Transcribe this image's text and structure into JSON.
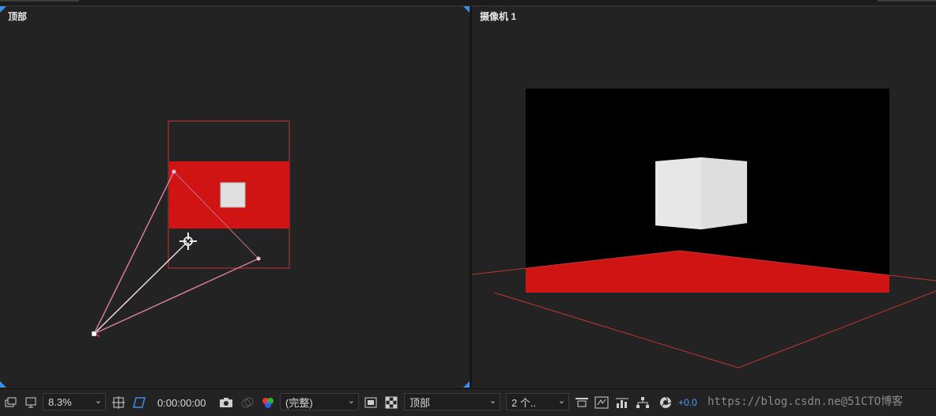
{
  "left_viewer": {
    "label": "顶部"
  },
  "right_viewer": {
    "label": "摄像机 1"
  },
  "toolbar": {
    "zoom": "8.3%",
    "timecode": "0:00:00:00",
    "resolution": "(完整)",
    "view": "顶部",
    "layout": "2 个..",
    "exposure": "+0.0"
  },
  "watermark": "https://blog.csdn.ne@51CTO博客",
  "colors": {
    "background": "#232323",
    "red": "#d01414",
    "cube": "#e3e3e3",
    "accent_blue": "#3b8fe6",
    "frame_line": "#c03434"
  },
  "icons": [
    "layers-icon",
    "monitor-icon",
    "grid-icon",
    "region-icon",
    "snapshot-icon",
    "show-snapshot-icon",
    "color-channels-icon",
    "fast-preview-icon",
    "transparency-grid-icon",
    "reset-exposure-icon",
    "flowchart-icon",
    "shutter-icon"
  ]
}
